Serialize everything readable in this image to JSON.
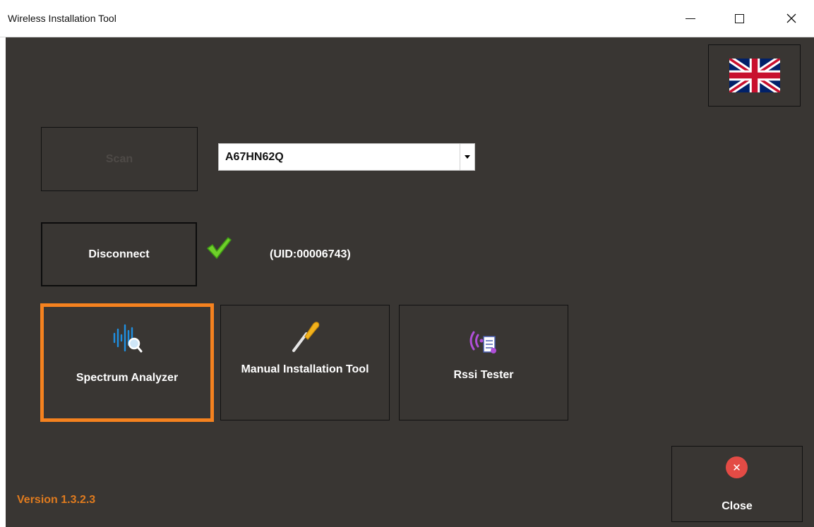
{
  "window": {
    "title": "Wireless Installation Tool",
    "controls": {
      "minimize": "minimize",
      "maximize": "maximize",
      "close": "close"
    }
  },
  "language": {
    "icon": "uk-flag-icon"
  },
  "scan": {
    "label": "Scan"
  },
  "device_select": {
    "value": "A67HN62Q"
  },
  "connection": {
    "button_label": "Disconnect",
    "status_icon": "checkmark-icon",
    "uid": "(UID:00006743)"
  },
  "tools": [
    {
      "label": "Spectrum Analyzer",
      "icon": "spectrum-analyzer-icon",
      "selected": true
    },
    {
      "label": "Manual Installation Tool",
      "icon": "screwdriver-icon",
      "selected": false
    },
    {
      "label": "Rssi Tester",
      "icon": "rssi-tester-icon",
      "selected": false
    }
  ],
  "version": "Version 1.3.2.3",
  "close": {
    "label": "Close",
    "icon": "close-circle-icon"
  },
  "colors": {
    "background": "#393633",
    "accent": "#f5821f",
    "version_text": "#e07b1e",
    "close_icon": "#e34b45"
  }
}
